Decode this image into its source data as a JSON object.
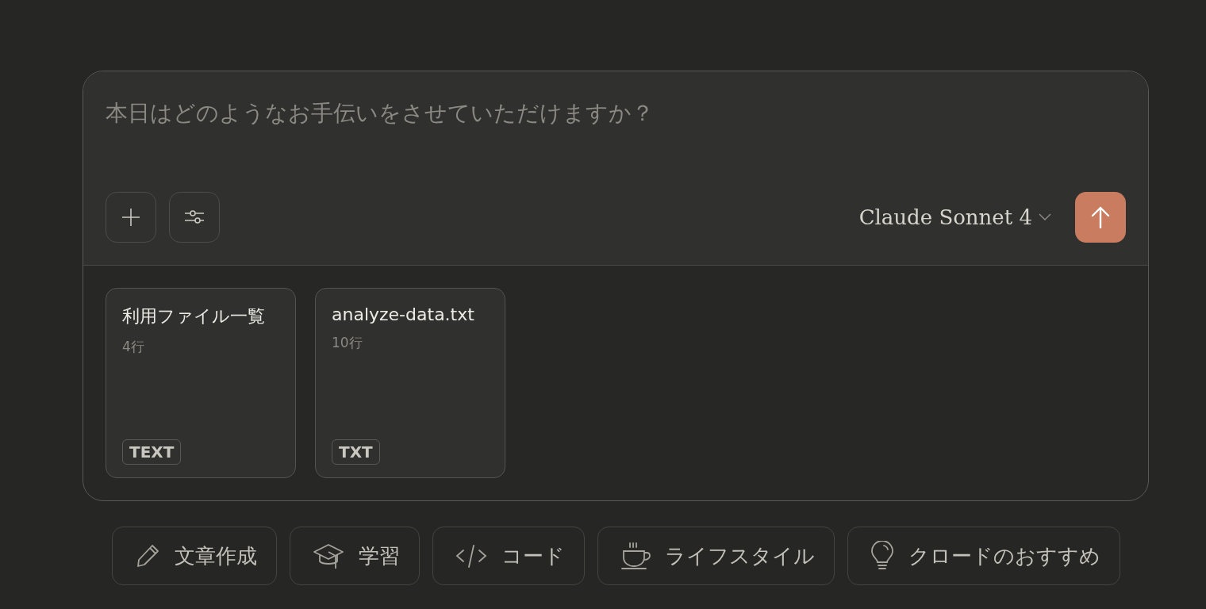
{
  "composer": {
    "placeholder": "本日はどのようなお手伝いをさせていただけますか？",
    "model": "Claude Sonnet 4"
  },
  "attachments": [
    {
      "title": "利用ファイル一覧",
      "lines": "4行",
      "badge": "TEXT"
    },
    {
      "title": "analyze-data.txt",
      "lines": "10行",
      "badge": "TXT"
    }
  ],
  "suggestions": [
    {
      "kind": "pencil",
      "label": "文章作成"
    },
    {
      "kind": "cap",
      "label": "学習"
    },
    {
      "kind": "code",
      "label": "コード"
    },
    {
      "kind": "cup",
      "label": "ライフスタイル"
    },
    {
      "kind": "bulb",
      "label": "クロードのおすすめ"
    }
  ]
}
